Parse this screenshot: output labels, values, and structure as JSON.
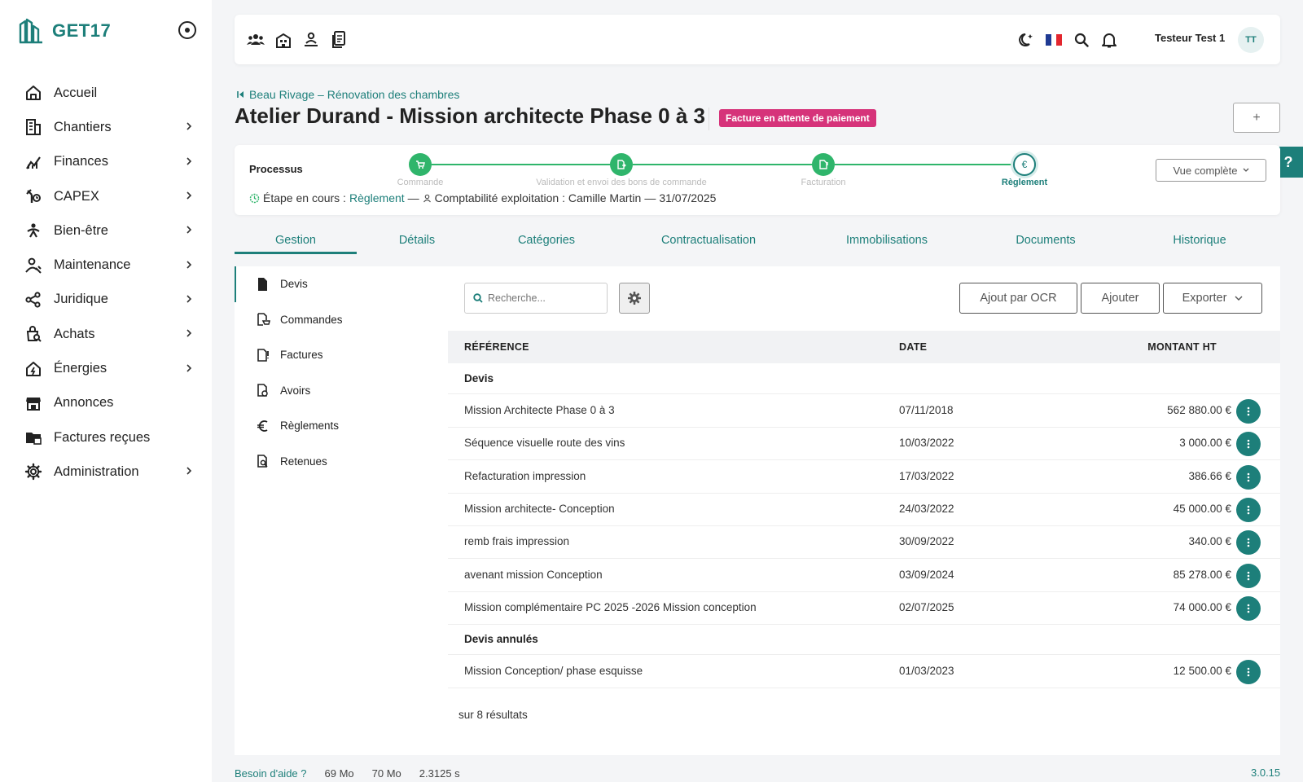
{
  "app": {
    "name": "GET17"
  },
  "sidebar": {
    "items": [
      {
        "label": "Accueil",
        "icon": "home-icon",
        "chevron": false
      },
      {
        "label": "Chantiers",
        "icon": "building-icon",
        "chevron": true
      },
      {
        "label": "Finances",
        "icon": "chart-icon",
        "chevron": true
      },
      {
        "label": "CAPEX",
        "icon": "tools-icon",
        "chevron": true
      },
      {
        "label": "Bien-être",
        "icon": "wellbeing-icon",
        "chevron": true
      },
      {
        "label": "Maintenance",
        "icon": "worker-icon",
        "chevron": true
      },
      {
        "label": "Juridique",
        "icon": "share-icon",
        "chevron": true
      },
      {
        "label": "Achats",
        "icon": "shopping-icon",
        "chevron": true
      },
      {
        "label": "Énergies",
        "icon": "energy-home-icon",
        "chevron": true
      },
      {
        "label": "Annonces",
        "icon": "store-icon",
        "chevron": false
      },
      {
        "label": "Factures reçues",
        "icon": "folder-icon",
        "chevron": false
      },
      {
        "label": "Administration",
        "icon": "gear-icon",
        "chevron": true
      }
    ]
  },
  "topbar": {
    "user_name": "Testeur Test 1",
    "avatar_initials": "TT"
  },
  "header": {
    "breadcrumb": "Beau Rivage – Rénovation des chambres",
    "title": "Atelier Durand - Mission architecte Phase 0 à 3",
    "status_badge": "Facture en attente de paiement",
    "plus_label": "+",
    "help_label": "?"
  },
  "process": {
    "title": "Processus",
    "steps": [
      {
        "label": "Commande",
        "done": true
      },
      {
        "label": "Validation et envoi des bons de commande",
        "done": true
      },
      {
        "label": "Facturation",
        "done": true
      },
      {
        "label": "Règlement",
        "done": false,
        "current": true
      }
    ],
    "current_prefix": "Étape en cours :",
    "current_value": "Règlement",
    "current_sep": "—",
    "responsible": "Comptabilité exploitation : Camille Martin",
    "date_sep": "—",
    "date": "31/07/2025",
    "view_label": "Vue complète"
  },
  "tabs": [
    {
      "label": "Gestion",
      "active": true
    },
    {
      "label": "Détails"
    },
    {
      "label": "Catégories"
    },
    {
      "label": "Contractualisation"
    },
    {
      "label": "Immobilisations"
    },
    {
      "label": "Documents"
    },
    {
      "label": "Historique"
    }
  ],
  "subnav": [
    {
      "label": "Devis",
      "active": true
    },
    {
      "label": "Commandes"
    },
    {
      "label": "Factures"
    },
    {
      "label": "Avoirs"
    },
    {
      "label": "Règlements"
    },
    {
      "label": "Retenues"
    }
  ],
  "toolbar": {
    "search_placeholder": "Recherche...",
    "ocr_label": "Ajout par OCR",
    "add_label": "Ajouter",
    "export_label": "Exporter"
  },
  "table": {
    "headers": {
      "reference": "RÉFÉRENCE",
      "date": "DATE",
      "amount": "MONTANT HT"
    },
    "groups": [
      {
        "title": "Devis",
        "rows": [
          {
            "reference": "Mission Architecte Phase 0 à 3",
            "date": "07/11/2018",
            "amount": "562 880.00 €"
          },
          {
            "reference": "Séquence visuelle route des vins",
            "date": "10/03/2022",
            "amount": "3 000.00 €"
          },
          {
            "reference": "Refacturation impression",
            "date": "17/03/2022",
            "amount": "386.66 €"
          },
          {
            "reference": "Mission architecte- Conception",
            "date": "24/03/2022",
            "amount": "45 000.00 €"
          },
          {
            "reference": "remb frais impression",
            "date": "30/09/2022",
            "amount": "340.00 €"
          },
          {
            "reference": "avenant mission Conception",
            "date": "03/09/2024",
            "amount": "85 278.00 €"
          },
          {
            "reference": "Mission complémentaire PC 2025 -2026 Mission conception",
            "date": "02/07/2025",
            "amount": "74 000.00 €"
          }
        ]
      },
      {
        "title": "Devis annulés",
        "rows": [
          {
            "reference": "Mission Conception/ phase esquisse",
            "date": "01/03/2023",
            "amount": "12 500.00 €"
          }
        ]
      }
    ],
    "result_count": "sur 8 résultats"
  },
  "footer": {
    "help": "Besoin d'aide ?",
    "mem1": "69 Mo",
    "mem2": "70 Mo",
    "time": "2.3125 s",
    "version": "3.0.15"
  },
  "colors": {
    "accent": "#1d7f7a",
    "success": "#2fb56b",
    "badge": "#d6337a"
  }
}
